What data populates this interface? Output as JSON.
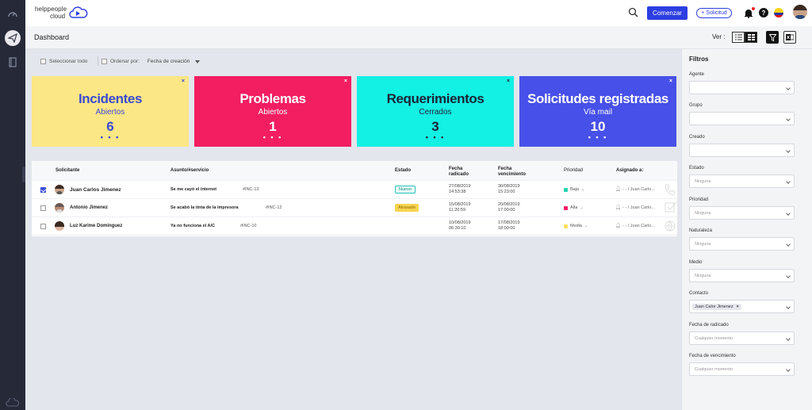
{
  "app": {
    "logo_line1": "helppeople",
    "logo_line2": "cloud"
  },
  "topbar": {
    "comenzar_label": "Comenzar",
    "solicitud_label": "+ Solicitud",
    "help_label": "?"
  },
  "header": {
    "title": "Dashboard",
    "ver_label": "Ver :"
  },
  "toolbar": {
    "select_all_label": "Seleccionar todo",
    "order_by_label": "Ordenar por:",
    "order_by_value": "Fecha de creación"
  },
  "cards": [
    {
      "title": "Incidentes",
      "subtitle": "Abiertos",
      "count": "6",
      "close": "×",
      "dots": "• • •",
      "color": "#fbe785"
    },
    {
      "title": "Problemas",
      "subtitle": "Abiertos",
      "count": "1",
      "close": "×",
      "dots": "• • •",
      "color": "#f31d62"
    },
    {
      "title": "Requerimientos",
      "subtitle": "Cerrados",
      "count": "3",
      "close": "×",
      "dots": "• • •",
      "color": "#13f0e4"
    },
    {
      "title": "Solicitudes registradas",
      "subtitle": "Vía mail",
      "count": "10",
      "close": "×",
      "dots": "• • •",
      "color": "#4750e8"
    }
  ],
  "table": {
    "headers": {
      "solicitante": "Solicitante",
      "asunto": "Asunto/#servicio",
      "estado": "Estado",
      "fecha_radicado_1": "Fecha",
      "fecha_radicado_2": "radicado",
      "fecha_venc_1": "Fecha",
      "fecha_venc_2": "vencimiento",
      "prioridad": "Prioridad",
      "asignado": "Asignado a:"
    },
    "rows": [
      {
        "checked": true,
        "name": "Juan Carlos Jimenez",
        "subject": "Se me cayó el internet",
        "code": "#INC-13",
        "status": "Nuevo",
        "rad_date": "27/08/2019",
        "rad_time": "14:53:38",
        "venc_date": "30/08/2019",
        "venc_time": "15:23:00",
        "priority": "Baja",
        "priority_color": "#27d3b0",
        "assigned": "- - / Juan Carlo..."
      },
      {
        "checked": false,
        "name": "Antonio Jimenez",
        "subject": "Se acabó la tinta de la impresora",
        "code": "#INC-12",
        "status": "Atrasado",
        "rad_date": "15/08/2019",
        "rad_time": "11:20:59",
        "venc_date": "20/08/2019",
        "venc_time": "17:00:00",
        "priority": "Alta",
        "priority_color": "#f31d62",
        "assigned": "- - / Juan Carlo..."
      },
      {
        "checked": false,
        "name": "Luz Karime Dominguez",
        "subject": "Ya no funciona el A/C",
        "code": "#INC-10",
        "status": "",
        "rad_date": "10/08/2019",
        "rad_time": "06:30:10",
        "venc_date": "17/08/2019",
        "venc_time": "18:00:00",
        "priority": "Media",
        "priority_color": "#f8e15a",
        "assigned": "- - / Juan Carlo..."
      }
    ]
  },
  "filters": {
    "title": "Filtros",
    "items": [
      {
        "label": "Agente",
        "value": ""
      },
      {
        "label": "Grupo",
        "value": ""
      },
      {
        "label": "Creado",
        "value": ""
      },
      {
        "label": "Estado",
        "value": "Ninguna"
      },
      {
        "label": "Prioridad",
        "value": "Ninguna"
      },
      {
        "label": "Naturaleza",
        "value": "Ninguna"
      },
      {
        "label": "Medio",
        "value": "Ninguna"
      },
      {
        "label": "Contacto",
        "value": "Juan Calor Jimenez"
      },
      {
        "label": "Fecha de radicado",
        "value": "Cualquier momento"
      },
      {
        "label": "Fecha de vencimiento",
        "value": "Cualquier momento"
      }
    ]
  },
  "colors": {
    "primary": "#2d3ee2",
    "sidebar": "#262a38",
    "background": "#e3e6ec"
  }
}
